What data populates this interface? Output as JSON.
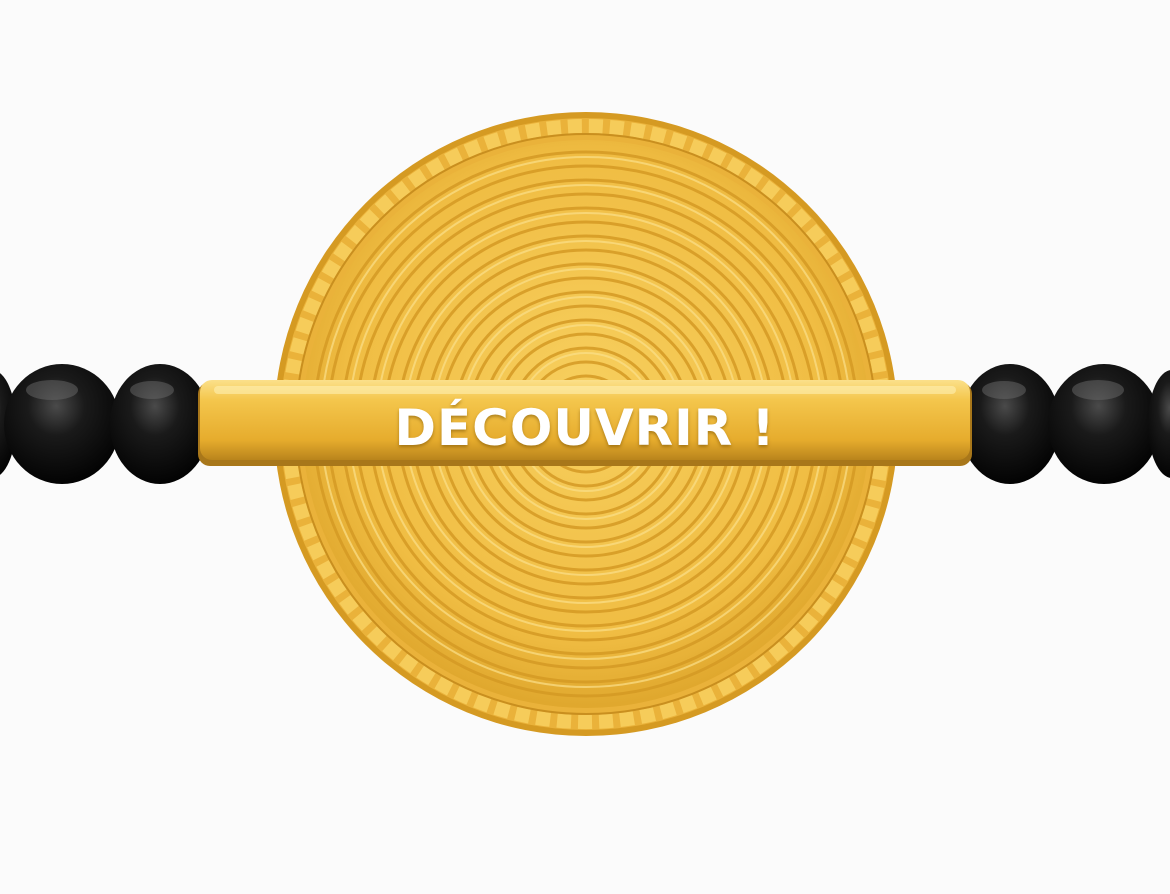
{
  "cta": {
    "label": "DÉCOUVRIR !"
  },
  "colors": {
    "background": "#fbfbfb",
    "gold": "#f2c04a",
    "gold_dark": "#c9901e",
    "bead": "#0e0e0e"
  },
  "icons": {
    "medallion": "gold-medallion-icon",
    "beads": "black-bead-icon"
  }
}
